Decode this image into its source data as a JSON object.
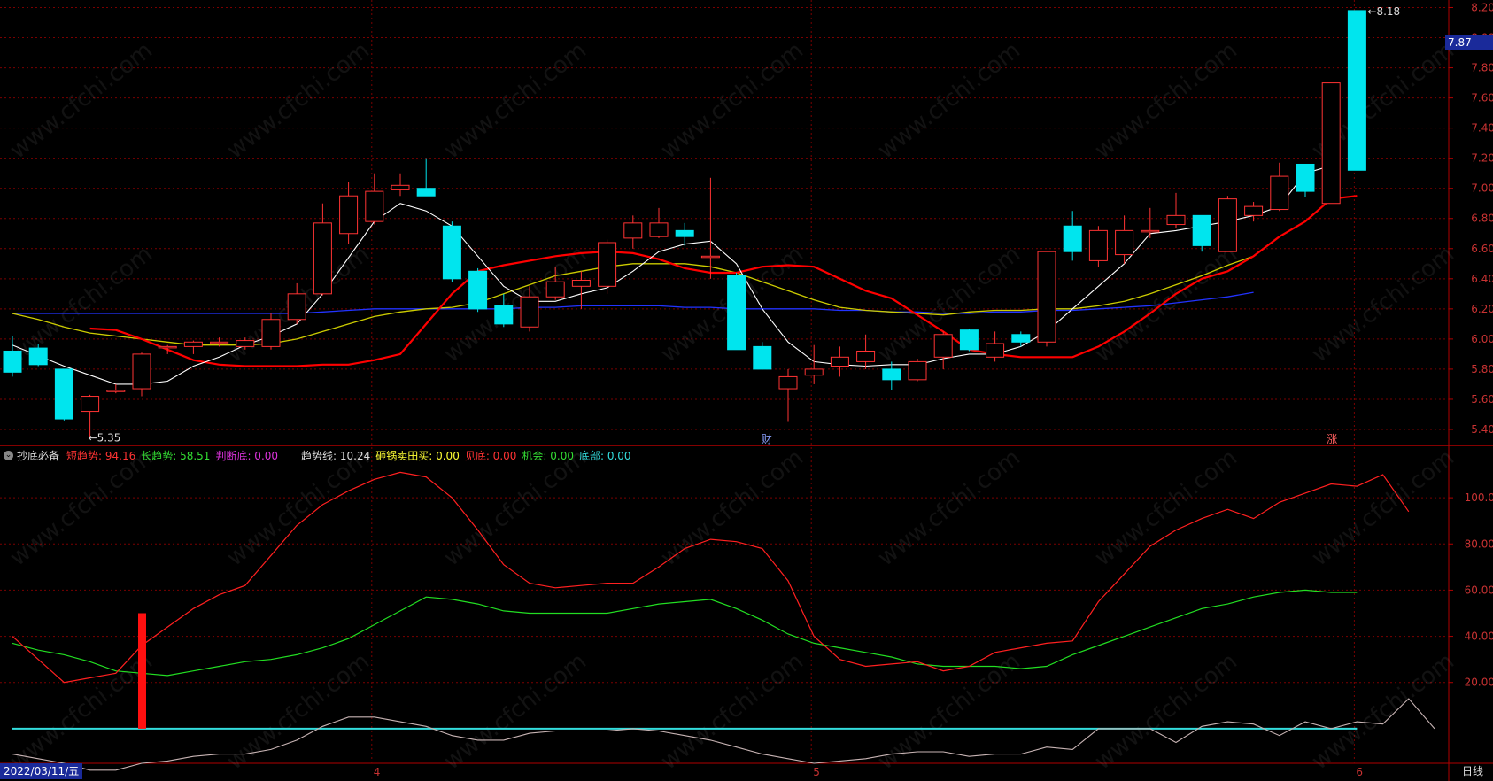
{
  "header": {
    "icon": "collapse-circle-icon",
    "indicator_name": "抄底必备",
    "items": [
      {
        "label": "短趋势:",
        "value": "94.16",
        "color": "#ff3333"
      },
      {
        "label": "长趋势:",
        "value": "58.51",
        "color": "#33dd33"
      },
      {
        "label": "判断底:",
        "value": "0.00",
        "color": "#dd33dd"
      },
      {
        "label": "趋势线:",
        "value": "10.24",
        "color": "#dddddd"
      },
      {
        "label": "砸锅卖田买:",
        "value": "0.00",
        "color": "#ffff33"
      },
      {
        "label": "见底:",
        "value": "0.00",
        "color": "#ff3333"
      },
      {
        "label": "机会:",
        "value": "0.00",
        "color": "#33dd33"
      },
      {
        "label": "底部:",
        "value": "0.00",
        "color": "#33dddd"
      }
    ]
  },
  "price_axis": {
    "ticks": [
      "8.20",
      "8.00",
      "7.80",
      "7.60",
      "7.40",
      "7.20",
      "7.00",
      "6.80",
      "6.60",
      "6.40",
      "6.20",
      "6.00",
      "5.80",
      "5.60",
      "5.40"
    ],
    "current_price": "7.87"
  },
  "indicator_axis": {
    "ticks": [
      "100.0",
      "80.00",
      "60.00",
      "40.00",
      "20.00"
    ]
  },
  "annotations": {
    "high_label": "8.18",
    "low_label": "5.35",
    "finance_marker": "财",
    "limit_up_marker": "涨"
  },
  "time_axis": {
    "date": "2022/03/11/五",
    "months": [
      "4",
      "5",
      "6"
    ],
    "period": "日线"
  },
  "watermark": "www.cfchi.com",
  "colors": {
    "up": "#ff3333",
    "down": "#00e5ee",
    "ma5": "#ffffff",
    "ma10": "#ff0000",
    "ma20": "#cccc00",
    "ma60": "#2233ff",
    "grid": "#7a0000"
  },
  "chart_data": {
    "type": "candlestick",
    "price_range": [
      5.3,
      8.25
    ],
    "indicator_range": [
      -15,
      115
    ],
    "candles": [
      [
        5.92,
        5.78,
        6.02,
        5.75
      ],
      [
        5.94,
        5.83,
        5.97,
        5.82
      ],
      [
        5.8,
        5.47,
        5.8,
        5.46
      ],
      [
        5.52,
        5.62,
        5.63,
        5.35
      ],
      [
        5.66,
        5.66,
        5.7,
        5.64
      ],
      [
        5.67,
        5.9,
        5.91,
        5.62
      ],
      [
        5.95,
        5.95,
        5.96,
        5.9
      ],
      [
        5.95,
        5.98,
        5.99,
        5.9
      ],
      [
        5.98,
        5.98,
        6.01,
        5.95
      ],
      [
        5.95,
        5.99,
        6.01,
        5.93
      ],
      [
        5.95,
        6.13,
        6.17,
        5.93
      ],
      [
        6.13,
        6.3,
        6.37,
        6.1
      ],
      [
        6.3,
        6.77,
        6.9,
        6.29
      ],
      [
        6.7,
        6.95,
        7.04,
        6.63
      ],
      [
        6.78,
        6.98,
        7.1,
        6.76
      ],
      [
        6.99,
        7.02,
        7.1,
        6.95
      ],
      [
        7.0,
        6.95,
        7.2,
        6.95
      ],
      [
        6.75,
        6.4,
        6.78,
        6.38
      ],
      [
        6.45,
        6.2,
        6.47,
        6.18
      ],
      [
        6.22,
        6.1,
        6.3,
        6.08
      ],
      [
        6.08,
        6.28,
        6.35,
        6.05
      ],
      [
        6.28,
        6.38,
        6.48,
        6.26
      ],
      [
        6.35,
        6.39,
        6.45,
        6.2
      ],
      [
        6.35,
        6.64,
        6.66,
        6.3
      ],
      [
        6.67,
        6.77,
        6.82,
        6.6
      ],
      [
        6.68,
        6.77,
        6.87,
        6.67
      ],
      [
        6.72,
        6.68,
        6.77,
        6.62
      ],
      [
        6.55,
        6.55,
        7.07,
        6.4
      ],
      [
        6.42,
        5.93,
        6.44,
        5.93
      ],
      [
        5.95,
        5.8,
        5.98,
        5.8
      ],
      [
        5.67,
        5.75,
        5.8,
        5.45
      ],
      [
        5.76,
        5.8,
        5.96,
        5.7
      ],
      [
        5.82,
        5.88,
        5.95,
        5.75
      ],
      [
        5.85,
        5.92,
        6.03,
        5.8
      ],
      [
        5.8,
        5.73,
        5.85,
        5.66
      ],
      [
        5.73,
        5.85,
        5.87,
        5.72
      ],
      [
        5.88,
        6.03,
        6.05,
        5.8
      ],
      [
        6.06,
        5.93,
        6.07,
        5.92
      ],
      [
        5.88,
        5.97,
        6.05,
        5.85
      ],
      [
        6.03,
        5.98,
        6.05,
        5.95
      ],
      [
        5.98,
        6.58,
        6.58,
        5.95
      ],
      [
        6.75,
        6.58,
        6.85,
        6.52
      ],
      [
        6.52,
        6.72,
        6.75,
        6.48
      ],
      [
        6.56,
        6.72,
        6.82,
        6.5
      ],
      [
        6.72,
        6.72,
        6.87,
        6.67
      ],
      [
        6.76,
        6.82,
        6.97,
        6.74
      ],
      [
        6.82,
        6.62,
        6.82,
        6.58
      ],
      [
        6.58,
        6.93,
        6.95,
        6.58
      ],
      [
        6.82,
        6.88,
        6.91,
        6.78
      ],
      [
        6.86,
        7.08,
        7.17,
        6.85
      ],
      [
        7.16,
        6.98,
        7.16,
        6.94
      ],
      [
        6.9,
        7.7,
        7.7,
        6.9
      ],
      [
        8.18,
        7.12,
        8.18,
        7.12
      ]
    ],
    "ma5": [
      5.96,
      5.89,
      5.82,
      5.76,
      5.7,
      5.7,
      5.72,
      5.82,
      5.88,
      5.96,
      6.02,
      6.1,
      6.3,
      6.54,
      6.78,
      6.9,
      6.85,
      6.75,
      6.55,
      6.35,
      6.25,
      6.25,
      6.3,
      6.34,
      6.45,
      6.58,
      6.63,
      6.65,
      6.5,
      6.2,
      5.98,
      5.85,
      5.83,
      5.82,
      5.83,
      5.83,
      5.87,
      5.9,
      5.9,
      5.95,
      6.05,
      6.2,
      6.35,
      6.5,
      6.7,
      6.72,
      6.75,
      6.78,
      6.82,
      6.88,
      7.1,
      7.15
    ],
    "ma10": [
      6.07,
      6.06,
      6.0,
      5.93,
      5.86,
      5.83,
      5.82,
      5.82,
      5.82,
      5.83,
      5.83,
      5.86,
      5.9,
      6.1,
      6.3,
      6.45,
      6.49,
      6.52,
      6.55,
      6.57,
      6.58,
      6.57,
      6.53,
      6.47,
      6.44,
      6.44,
      6.48,
      6.49,
      6.48,
      6.4,
      6.32,
      6.27,
      6.16,
      6.05,
      5.93,
      5.9,
      5.88,
      5.88,
      5.88,
      5.95,
      6.05,
      6.17,
      6.3,
      6.4,
      6.45,
      6.55,
      6.68,
      6.78,
      6.93,
      6.95
    ],
    "ma20": [
      6.17,
      6.13,
      6.08,
      6.04,
      6.02,
      6.0,
      5.98,
      5.96,
      5.96,
      5.96,
      5.97,
      6.0,
      6.05,
      6.1,
      6.15,
      6.18,
      6.2,
      6.21,
      6.24,
      6.3,
      6.36,
      6.42,
      6.45,
      6.48,
      6.5,
      6.5,
      6.5,
      6.48,
      6.44,
      6.38,
      6.32,
      6.26,
      6.21,
      6.19,
      6.18,
      6.17,
      6.16,
      6.18,
      6.19,
      6.19,
      6.2,
      6.2,
      6.22,
      6.25,
      6.3,
      6.36,
      6.42,
      6.49,
      6.55
    ],
    "ma60": [
      6.17,
      6.17,
      6.17,
      6.17,
      6.17,
      6.17,
      6.17,
      6.17,
      6.17,
      6.17,
      6.17,
      6.17,
      6.18,
      6.19,
      6.2,
      6.2,
      6.2,
      6.2,
      6.2,
      6.2,
      6.21,
      6.21,
      6.22,
      6.22,
      6.22,
      6.22,
      6.21,
      6.21,
      6.2,
      6.2,
      6.2,
      6.2,
      6.19,
      6.19,
      6.18,
      6.18,
      6.17,
      6.17,
      6.18,
      6.18,
      6.19,
      6.19,
      6.2,
      6.21,
      6.22,
      6.24,
      6.26,
      6.28,
      6.31
    ],
    "short_trend": [
      40,
      30,
      20,
      22,
      24,
      36,
      44,
      52,
      58,
      62,
      75,
      88,
      97,
      103,
      108,
      111,
      109,
      100,
      86,
      71,
      63,
      61,
      62,
      63,
      63,
      70,
      78,
      82,
      81,
      78,
      64,
      40,
      30,
      27,
      28,
      29,
      25,
      27,
      33,
      35,
      37,
      38,
      55,
      67,
      79,
      86,
      91,
      95,
      91,
      98,
      102,
      106,
      105,
      110,
      94
    ],
    "long_trend": [
      37,
      34,
      32,
      29,
      25,
      24,
      23,
      25,
      27,
      29,
      30,
      32,
      35,
      39,
      45,
      51,
      57,
      56,
      54,
      51,
      50,
      50,
      50,
      50,
      52,
      54,
      55,
      56,
      52,
      47,
      41,
      37,
      35,
      33,
      31,
      28,
      27,
      27,
      27,
      26,
      27,
      32,
      36,
      40,
      44,
      48,
      52,
      54,
      57,
      59,
      60,
      59,
      59
    ],
    "trend_line": [
      -11,
      -13,
      -15,
      -18,
      -18,
      -15,
      -14,
      -12,
      -11,
      -11,
      -9,
      -5,
      1,
      5,
      5,
      3,
      1,
      -3,
      -5,
      -5,
      -2,
      -1,
      -1,
      -1,
      0,
      -1,
      -3,
      -5,
      -8,
      -11,
      -13,
      -15,
      -14,
      -13,
      -11,
      -10,
      -10,
      -12,
      -11,
      -11,
      -8,
      -9,
      0,
      0,
      0,
      -6,
      1,
      3,
      2,
      -3,
      3,
      0,
      3,
      2,
      13,
      0
    ],
    "bottom_line_value": 0,
    "signal_bar_index": 5,
    "signal_bar_range": [
      0,
      50
    ]
  }
}
